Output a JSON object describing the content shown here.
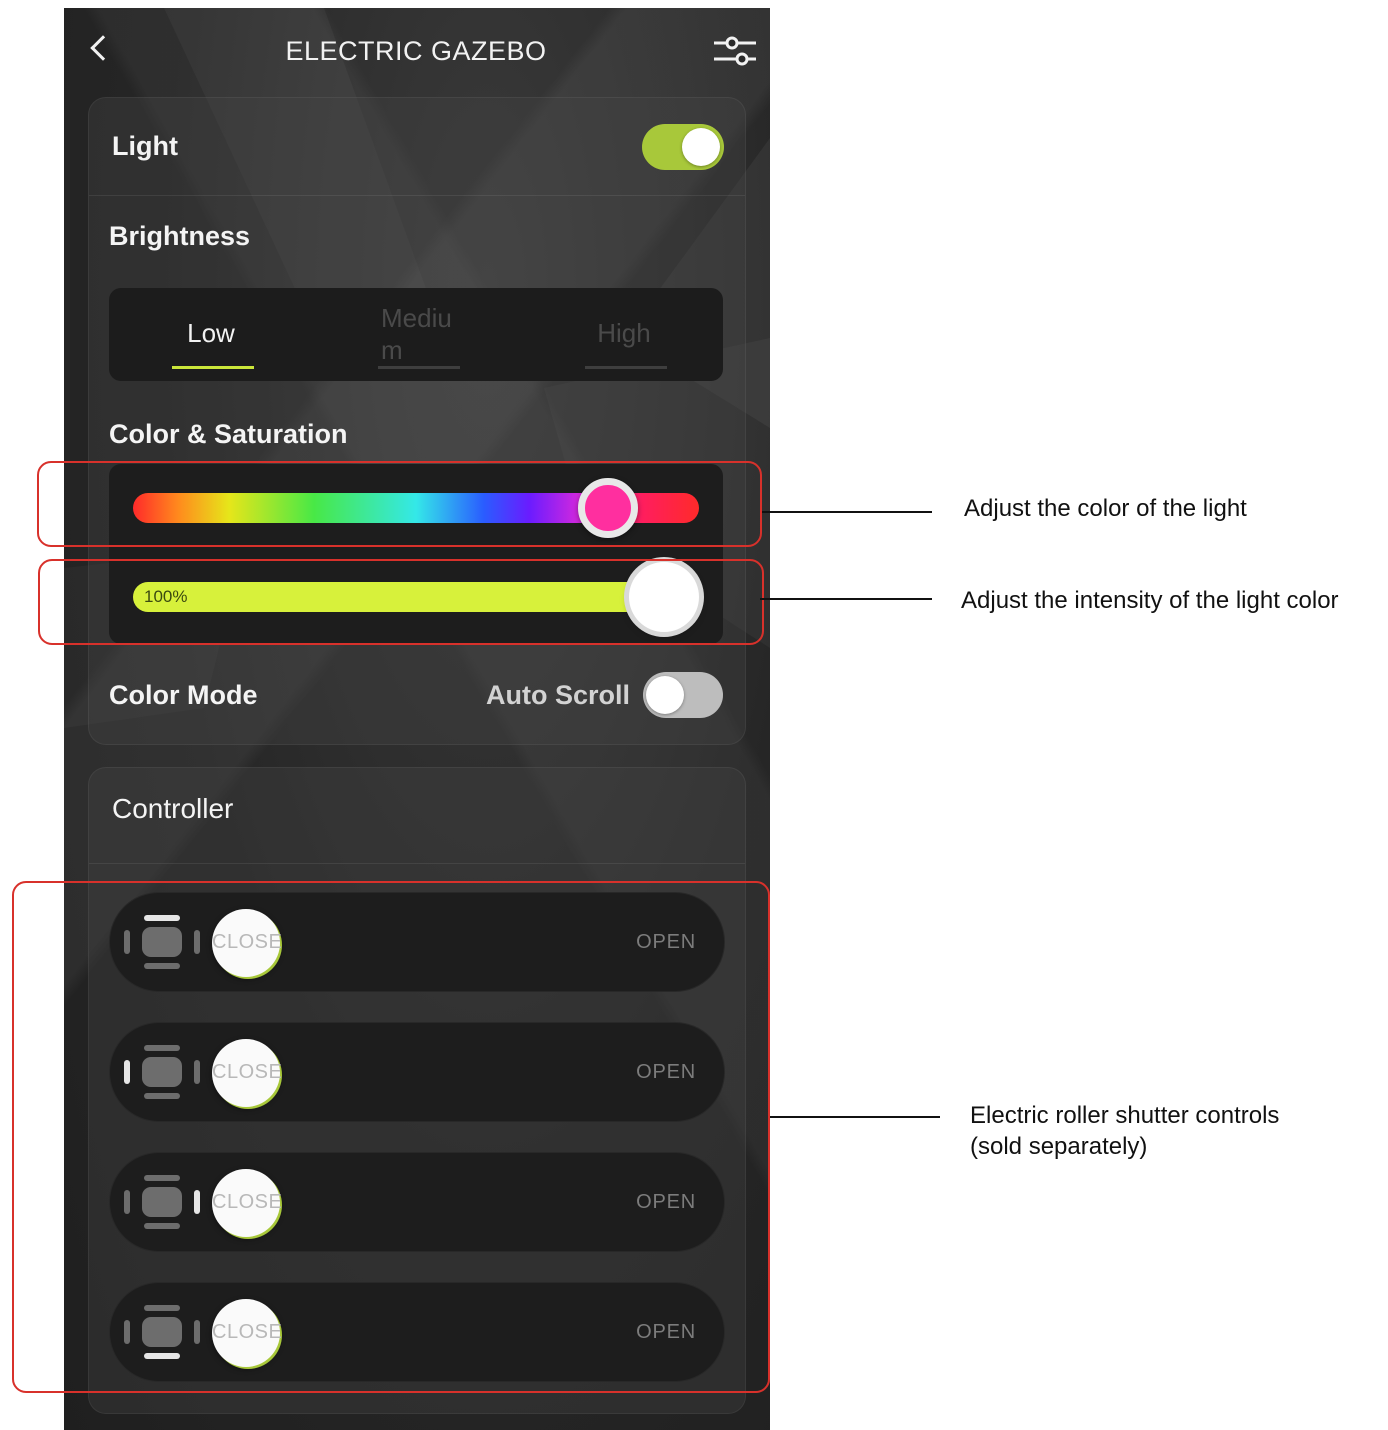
{
  "header": {
    "title": "ELECTRIC GAZEBO",
    "back_icon": "chevron-left-icon",
    "settings_icon": "sliders-icon"
  },
  "light": {
    "label": "Light",
    "enabled": true,
    "accent_color": "#a8c83a"
  },
  "brightness": {
    "label": "Brightness",
    "options": [
      "Low",
      "Mediu m",
      "High"
    ],
    "selected": "Low"
  },
  "color": {
    "label": "Color & Saturation",
    "hue_position": 0.84,
    "hue_color": "#ff2f9f",
    "saturation_text": "100%",
    "saturation_percent": 100,
    "saturation_color": "#d7f13b"
  },
  "color_mode": {
    "label": "Color Mode",
    "auto_scroll_label": "Auto Scroll",
    "auto_scroll_enabled": false
  },
  "controller": {
    "label": "Controller",
    "shutters": [
      {
        "close_label": "CLOSE",
        "open_label": "OPEN"
      },
      {
        "close_label": "CLOSE",
        "open_label": "OPEN"
      },
      {
        "close_label": "CLOSE",
        "open_label": "OPEN"
      },
      {
        "close_label": "CLOSE",
        "open_label": "OPEN"
      }
    ]
  },
  "annotations": {
    "color_note": "Adjust the color of the light",
    "intensity_note": "Adjust the intensity of the light color",
    "shutter_note_line1": "Electric roller shutter controls",
    "shutter_note_line2": "(sold separately)",
    "highlight_color": "#d8312b"
  }
}
